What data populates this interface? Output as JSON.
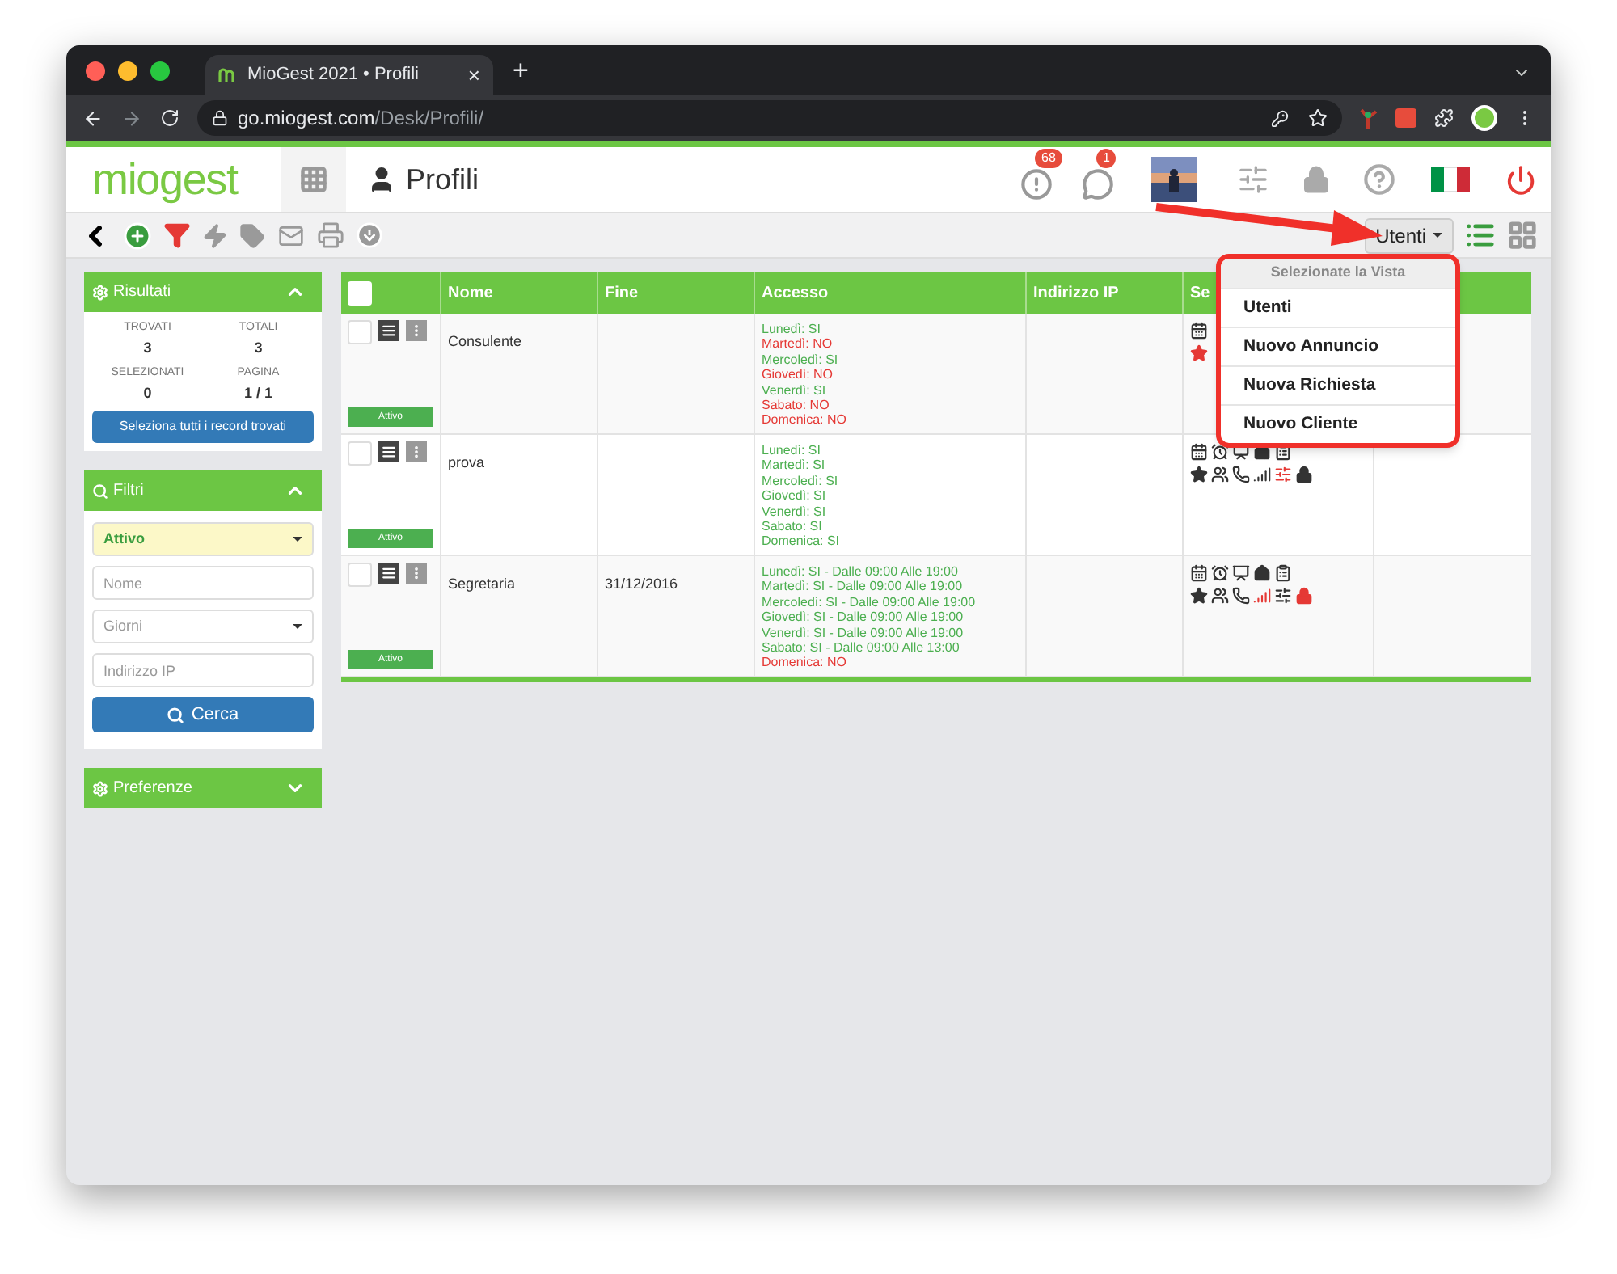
{
  "browser": {
    "tab_title": "MioGest 2021 • Profili",
    "tab_close": "×",
    "new_tab": "+",
    "url": {
      "domain": "go.miogest.com",
      "path": "/Desk/Profili/"
    }
  },
  "header": {
    "logo": "miogest",
    "page_title": "Profili",
    "notifications": [
      {
        "kind": "alert",
        "count": "68"
      },
      {
        "kind": "chat",
        "count": "1"
      }
    ]
  },
  "toolbar": {
    "view_button": "Utenti",
    "views": [
      {
        "kind": "list",
        "selected": true
      },
      {
        "kind": "grid",
        "selected": false
      }
    ]
  },
  "view_menu": {
    "header": "Selezionate la Vista",
    "items": [
      "Utenti",
      "Nuovo Annuncio",
      "Nuova Richiesta",
      "Nuovo Cliente"
    ]
  },
  "sidebar": {
    "results": {
      "title": "Risultati",
      "expanded": true,
      "stats": [
        {
          "label": "TROVATI",
          "value": "3"
        },
        {
          "label": "TOTALI",
          "value": "3"
        },
        {
          "label": "SELEZIONATI",
          "value": "0"
        },
        {
          "label": "PAGINA",
          "value": "1 / 1"
        }
      ],
      "button": "Seleziona tutti i record trovati"
    },
    "filters": {
      "title": "Filtri",
      "expanded": true,
      "fields": [
        {
          "kind": "select",
          "value": "Attivo",
          "active": true
        },
        {
          "kind": "text",
          "placeholder": "Nome"
        },
        {
          "kind": "select",
          "placeholder": "Giorni",
          "active": false
        },
        {
          "kind": "text",
          "placeholder": "Indirizzo IP"
        }
      ],
      "button": "Cerca"
    },
    "preferences": {
      "title": "Preferenze",
      "expanded": false
    }
  },
  "table": {
    "all_checked": false,
    "columns": [
      "Nome",
      "Fine",
      "Accesso",
      "Indirizzo IP",
      "Se"
    ],
    "rows": [
      {
        "checked": false,
        "name": "Consulente",
        "end": "",
        "status": "Attivo",
        "access": [
          {
            "text": "Lunedì: SI",
            "ok": true
          },
          {
            "text": "Martedì: NO",
            "ok": false
          },
          {
            "text": "Mercoledì: SI",
            "ok": true
          },
          {
            "text": "Giovedì: NO",
            "ok": false
          },
          {
            "text": "Venerdì: SI",
            "ok": true
          },
          {
            "text": "Sabato: NO",
            "ok": false
          },
          {
            "text": "Domenica: NO",
            "ok": false
          }
        ],
        "icons_top": [
          {
            "kind": "calendar",
            "alert": false
          }
        ],
        "icons_bottom": [
          {
            "kind": "star",
            "alert": true
          }
        ]
      },
      {
        "checked": false,
        "name": "prova",
        "end": "",
        "status": "Attivo",
        "access": [
          {
            "text": "Lunedì: SI",
            "ok": true
          },
          {
            "text": "Martedì: SI",
            "ok": true
          },
          {
            "text": "Mercoledì: SI",
            "ok": true
          },
          {
            "text": "Giovedì: SI",
            "ok": true
          },
          {
            "text": "Venerdì: SI",
            "ok": true
          },
          {
            "text": "Sabato: SI",
            "ok": true
          },
          {
            "text": "Domenica: SI",
            "ok": true
          }
        ],
        "icons_top": [
          {
            "kind": "calendar",
            "alert": false
          },
          {
            "kind": "clock",
            "alert": false
          },
          {
            "kind": "easel",
            "alert": false
          },
          {
            "kind": "home",
            "alert": false
          },
          {
            "kind": "list",
            "alert": false
          }
        ],
        "icons_bottom": [
          {
            "kind": "star",
            "alert": false
          },
          {
            "kind": "users",
            "alert": false
          },
          {
            "kind": "phone",
            "alert": false
          },
          {
            "kind": "signal",
            "alert": false
          },
          {
            "kind": "sliders",
            "alert": true
          },
          {
            "kind": "lock",
            "alert": false
          }
        ]
      },
      {
        "checked": false,
        "name": "Segretaria",
        "end": "31/12/2016",
        "status": "Attivo",
        "access": [
          {
            "text": "Lunedì: SI - Dalle 09:00 Alle 19:00",
            "ok": true
          },
          {
            "text": "Martedì: SI - Dalle 09:00 Alle 19:00",
            "ok": true
          },
          {
            "text": "Mercoledì: SI - Dalle 09:00 Alle 19:00",
            "ok": true
          },
          {
            "text": "Giovedì: SI - Dalle 09:00 Alle 19:00",
            "ok": true
          },
          {
            "text": "Venerdì: SI - Dalle 09:00 Alle 19:00",
            "ok": true
          },
          {
            "text": "Sabato: SI - Dalle 09:00 Alle 13:00",
            "ok": true
          },
          {
            "text": "Domenica: NO",
            "ok": false
          }
        ],
        "icons_top": [
          {
            "kind": "calendar",
            "alert": false
          },
          {
            "kind": "clock",
            "alert": false
          },
          {
            "kind": "easel",
            "alert": false
          },
          {
            "kind": "home",
            "alert": false
          },
          {
            "kind": "list",
            "alert": false
          }
        ],
        "icons_bottom": [
          {
            "kind": "star",
            "alert": false
          },
          {
            "kind": "users",
            "alert": false
          },
          {
            "kind": "phone",
            "alert": false
          },
          {
            "kind": "signal",
            "alert": true
          },
          {
            "kind": "sliders",
            "alert": false
          },
          {
            "kind": "lock",
            "alert": true
          }
        ]
      }
    ]
  }
}
